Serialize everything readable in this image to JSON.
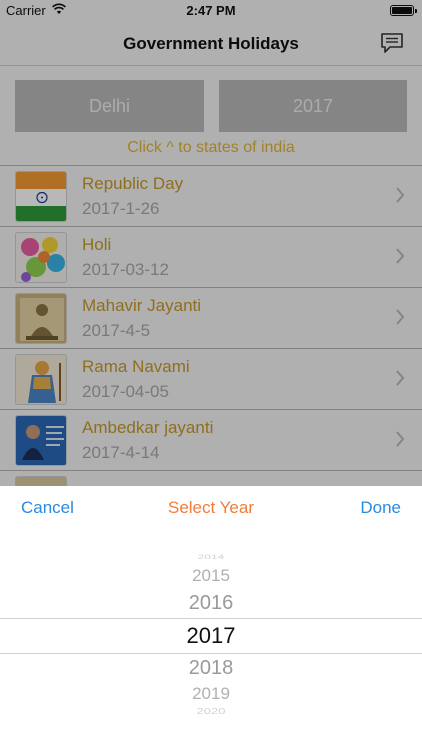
{
  "status_bar": {
    "carrier": "Carrier",
    "time": "2:47 PM"
  },
  "nav": {
    "title": "Government Holidays",
    "icon": "chat-icon"
  },
  "selectors": {
    "state": "Delhi",
    "year": "2017"
  },
  "hint": "Click ^ to states of india",
  "holidays": [
    {
      "name": "Republic Day",
      "date": "2017-1-26"
    },
    {
      "name": "Holi",
      "date": "2017-03-12"
    },
    {
      "name": "Mahavir Jayanti",
      "date": "2017-4-5"
    },
    {
      "name": "Rama Navami",
      "date": "2017-04-05"
    },
    {
      "name": "Ambedkar jayanti",
      "date": "2017-4-14"
    }
  ],
  "picker": {
    "cancel": "Cancel",
    "title": "Select Year",
    "done": "Done",
    "options": [
      "2014",
      "2015",
      "2016",
      "2017",
      "2018",
      "2019",
      "2020"
    ],
    "selected": "2017"
  },
  "colors": {
    "accent_blue": "#2a8adf",
    "title_orange": "#f07c3a",
    "holiday_gold": "#c79a2a",
    "hint_yellow": "#e0b43a"
  }
}
